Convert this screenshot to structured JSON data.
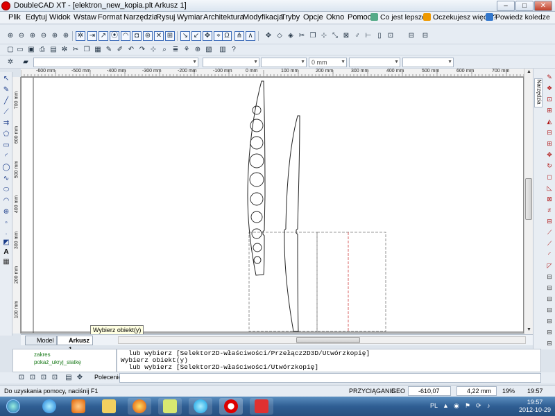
{
  "window": {
    "app_name": "DoubleCAD XT",
    "title": "DoubleCAD XT - [elektron_new_kopia.plt Arkusz 1]"
  },
  "menu": {
    "items": [
      "Plik",
      "Edytuj",
      "Widok",
      "Wstaw",
      "Format",
      "Narzędzia",
      "Rysuj",
      "Wymiar",
      "Architektura",
      "Modyfikacja",
      "Tryby",
      "Opcje",
      "Okno",
      "Pomoc"
    ],
    "extras": [
      "Co jest lepsze?",
      "Oczekujesz więcej?",
      "Powiedz koledze"
    ]
  },
  "property_bar": {
    "field1": "",
    "field2": "",
    "field3": "0 mm",
    "field4": "",
    "field5": ""
  },
  "ruler": {
    "h_labels": [
      "-600 mm",
      "-500 mm",
      "-400 mm",
      "-300 mm",
      "-200 mm",
      "-100 mm",
      "0 mm",
      "100 mm",
      "200 mm",
      "300 mm",
      "400 mm",
      "500 mm",
      "600 mm",
      "700 mm"
    ],
    "v_labels": [
      "700 mm",
      "600 mm",
      "500 mm",
      "400 mm",
      "300 mm",
      "200 mm",
      "100 mm"
    ]
  },
  "tooltip": "Wybierz obiekt(y)",
  "sheet_tabs": [
    {
      "label": "Model",
      "active": false
    },
    {
      "label": "Arkusz 1",
      "active": true
    }
  ],
  "right_panel": {
    "tab_label": "Narzędzia"
  },
  "tree": {
    "items": [
      "zakres",
      "pokaż_ukryj_siatkę"
    ]
  },
  "command_history": [
    "  lub wybierz [Selektor2D-właściwości/Przełącz2D3D/Utwórzkopię]",
    "Wybierz obiekt(y)",
    "  lub wybierz [Selektor2D-właściwości/Utwórzkopię]"
  ],
  "command": {
    "label": "Polecenie:",
    "value": ""
  },
  "status": {
    "help": "Do uzyskania pomocy, naciśnij F1",
    "snap": "PRZYCIĄGANIE",
    "geo": "GEO",
    "x": "-610,07 mm",
    "y": "4,22 mm",
    "zoom": "19%",
    "time": "19:57"
  },
  "taskbar": {
    "lang": "PL",
    "time": "19:57",
    "date": "2012-10-29"
  }
}
